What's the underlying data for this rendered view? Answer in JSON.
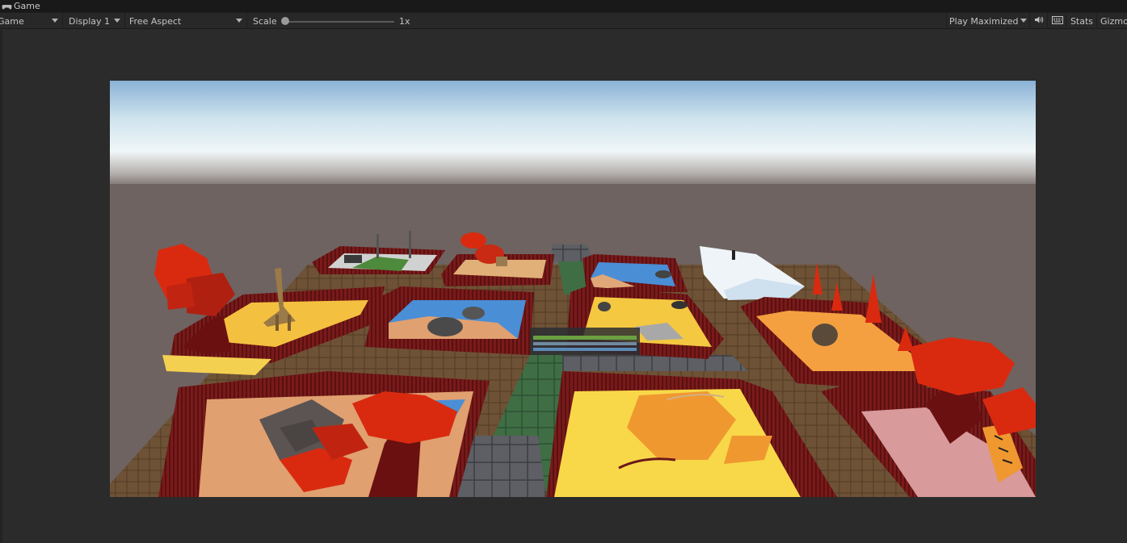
{
  "tab": {
    "label": "Game"
  },
  "toolbar": {
    "game_view_dropdown": "Game",
    "display_dropdown": "Display 1",
    "aspect_dropdown": "Free Aspect",
    "scale_label": "Scale",
    "scale_value_label": "1x",
    "scale_fraction": 0,
    "play_mode_dropdown": "Play Maximized",
    "stats_button": "Stats",
    "gizmos_button": "Gizmo"
  },
  "colors": {
    "fence": "#6b1414",
    "path": "#6e5236",
    "grass": "#3f6e45",
    "sand": "#e0b070",
    "water": "#4a8ed6",
    "ground": "#6e6360",
    "tree_red": "#d92a10"
  }
}
